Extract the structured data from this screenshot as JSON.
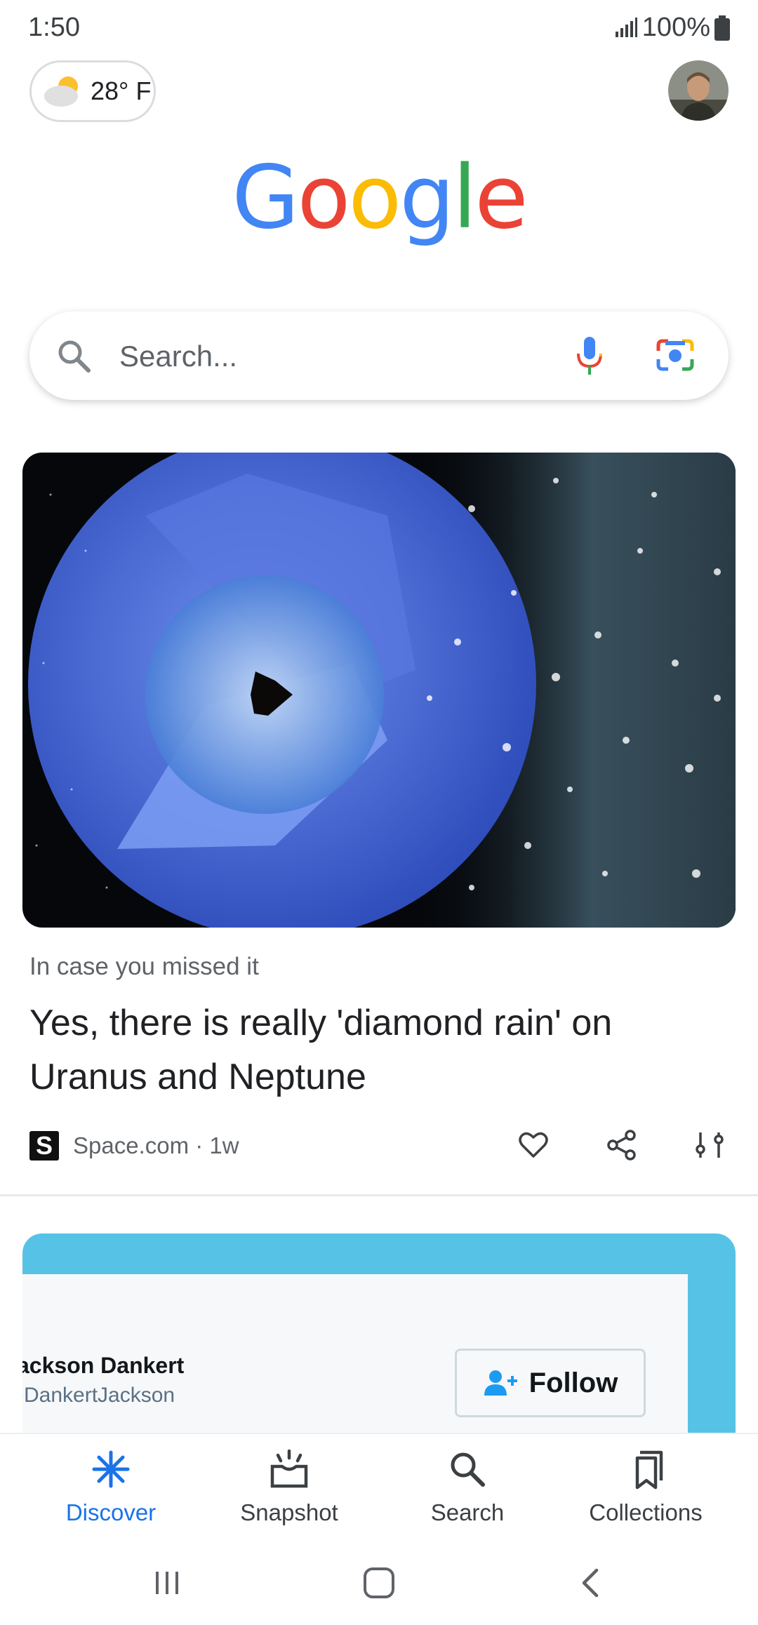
{
  "status_bar": {
    "time": "1:50",
    "battery": "100%"
  },
  "weather": {
    "temperature": "28° F",
    "icon": "partly-cloudy-icon"
  },
  "logo": {
    "letters": [
      "G",
      "o",
      "o",
      "g",
      "l",
      "e"
    ],
    "colors": [
      "#4285F4",
      "#EA4335",
      "#FBBC05",
      "#4285F4",
      "#34A853",
      "#EA4335"
    ]
  },
  "search": {
    "placeholder": "Search..."
  },
  "feed_card": {
    "label": "In case you missed it",
    "title": "Yes, there is really 'diamond rain' on Uranus and Neptune",
    "source_initial": "S",
    "source": "Space.com · 1w"
  },
  "second_card": {
    "name": "ackson Dankert",
    "handle": ")DankertJackson",
    "follow_label": "Follow"
  },
  "bottom_nav": {
    "items": [
      {
        "label": "Discover",
        "icon": "discover-icon",
        "active": true
      },
      {
        "label": "Snapshot",
        "icon": "snapshot-icon"
      },
      {
        "label": "Search",
        "icon": "search-icon"
      },
      {
        "label": "Collections",
        "icon": "collections-icon"
      }
    ]
  },
  "colors": {
    "accent": "#1a73e8",
    "twitter_banner": "#56c3e6"
  }
}
